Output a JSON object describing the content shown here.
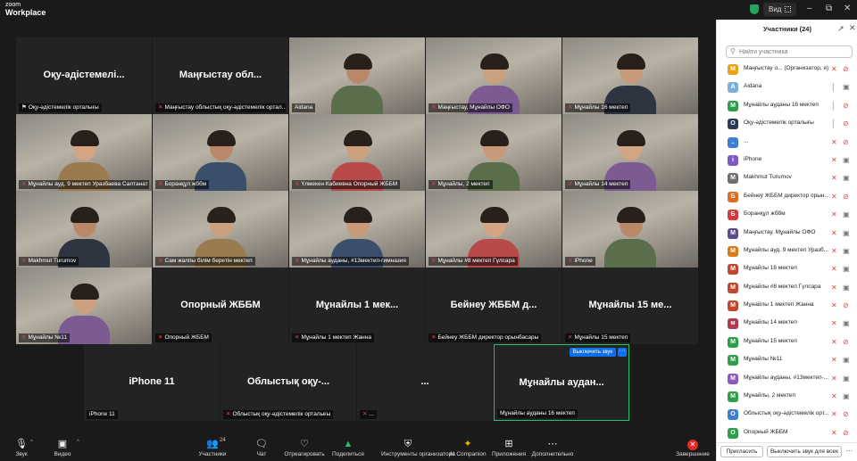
{
  "app": {
    "logo_line1": "zoom",
    "logo_line2": "Workplace",
    "view_label": "Вид",
    "colors": {
      "accent": "#0e71eb",
      "active_border": "#23c06a",
      "muted": "#e0454a",
      "security": "#23a55a"
    }
  },
  "tiles": [
    {
      "big": "Оқу-әдістемелі...",
      "caption": "Оқу-әдістемелік орталығы",
      "video": false,
      "pinned": true,
      "muted": false
    },
    {
      "big": "Маңғыстау обл...",
      "caption": "Маңғыстау облыстық оқу-әдістемелік ортал...",
      "video": false,
      "pinned": false,
      "muted": true
    },
    {
      "big": "",
      "caption": "Aidana",
      "video": true,
      "pinned": false,
      "muted": false
    },
    {
      "big": "",
      "caption": "Маңғыстау, Мұнайлы ОФО",
      "video": true,
      "pinned": false,
      "muted": true
    },
    {
      "big": "",
      "caption": "Мұнайлы 16 мектеп",
      "video": true,
      "pinned": false,
      "muted": true
    },
    {
      "big": "",
      "caption": "Мұнайлы ауд. 9 мектеп Уразбаева Салтанат ...",
      "video": true,
      "pinned": false,
      "muted": true
    },
    {
      "big": "",
      "caption": "Боранқұл жббм",
      "video": true,
      "pinned": false,
      "muted": true
    },
    {
      "big": "",
      "caption": "Үлмекен Кабиевна Опорный ЖББМ",
      "video": true,
      "pinned": false,
      "muted": true
    },
    {
      "big": "",
      "caption": "Мұнайлы, 2 мектеп",
      "video": true,
      "pinned": false,
      "muted": true
    },
    {
      "big": "",
      "caption": "Мұнайлы 14 мектеп",
      "video": true,
      "pinned": false,
      "muted": true
    },
    {
      "big": "",
      "caption": "Makhmut Turumov",
      "video": true,
      "pinned": false,
      "muted": true
    },
    {
      "big": "",
      "caption": "Сам жалпы білім беретін мектеп",
      "video": true,
      "pinned": false,
      "muted": true
    },
    {
      "big": "",
      "caption": "Мұнайлы ауданы, #13мектеп-гимназия",
      "video": true,
      "pinned": false,
      "muted": true
    },
    {
      "big": "",
      "caption": "Мұнайлы #8 мектеп Гүлсара",
      "video": true,
      "pinned": false,
      "muted": true
    },
    {
      "big": "",
      "caption": "iPhone",
      "video": true,
      "pinned": false,
      "muted": true
    },
    {
      "big": "",
      "caption": "Мұнайлы №11",
      "video": true,
      "pinned": false,
      "muted": true
    },
    {
      "big": "Опорный ЖББМ",
      "caption": "Опорный ЖББМ",
      "video": false,
      "pinned": false,
      "muted": true
    },
    {
      "big": "Мұнайлы 1 мек...",
      "caption": "Мұнайлы 1 мектеп Жанна",
      "video": false,
      "pinned": false,
      "muted": true
    },
    {
      "big": "Бейнеу ЖББМ д...",
      "caption": "Бейнеу ЖББМ директор орынбасары",
      "video": false,
      "pinned": false,
      "muted": true
    },
    {
      "big": "Мұнайлы 15 ме...",
      "caption": "Мұнайлы 15 мектеп",
      "video": false,
      "pinned": false,
      "muted": true
    },
    {
      "big": "iPhone 11",
      "caption": "iPhone 11",
      "video": false,
      "pinned": false,
      "muted": false
    },
    {
      "big": "Облыстық оқу-...",
      "caption": "Облыстық оқу-әдістемелік орталығы",
      "video": false,
      "pinned": false,
      "muted": true
    },
    {
      "big": "...",
      "caption": "...",
      "video": false,
      "pinned": false,
      "muted": true
    },
    {
      "big": "Мұнайлы аудан...",
      "caption": "Мұнайлы ауданы 16 мектеп",
      "video": false,
      "pinned": false,
      "muted": false,
      "active": true,
      "unmute_label": "Выключить звук",
      "more_label": "···"
    }
  ],
  "toolbar": {
    "audio": "Звук",
    "video": "Видео",
    "participants": "Участники",
    "participants_count": "24",
    "chat": "Чат",
    "react": "Отреагировать",
    "share": "Поделиться",
    "host_tools": "Инструменты организатора",
    "ai": "AI Companion",
    "apps": "Приложения",
    "more": "Дополнительно",
    "end": "Завершение"
  },
  "panel": {
    "title": "Участники (24)",
    "search_placeholder": "Найти участника",
    "invite": "Пригласить",
    "mute_all": "Выключить звук для всех",
    "more": "···",
    "participants": [
      {
        "initial": "М",
        "name": "Маңғыстау о... (Организатор, я)",
        "color": "#e8a317",
        "mic": "muted",
        "cam": "off"
      },
      {
        "initial": "A",
        "name": "Aidana",
        "color": "#7bb0d8",
        "mic": "on",
        "cam": "on"
      },
      {
        "initial": "М",
        "name": "Мұнайлы ауданы 16 мектеп",
        "color": "#2e9e4a",
        "mic": "on",
        "cam": "off"
      },
      {
        "initial": "О",
        "name": "Оқу-әдістемелік орталығы",
        "color": "#2b3a55",
        "mic": "on",
        "cam": "off"
      },
      {
        "initial": "..",
        "name": "...",
        "color": "#3d7fd1",
        "mic": "muted",
        "cam": "off"
      },
      {
        "initial": "i",
        "name": "iPhone",
        "color": "#7d5bbe",
        "mic": "muted",
        "cam": "on"
      },
      {
        "initial": "M",
        "name": "Makhmut Turumov",
        "color": "#6f6f6f",
        "mic": "muted",
        "cam": "on"
      },
      {
        "initial": "Б",
        "name": "Бейнеу ЖББМ директор орын...",
        "color": "#e26b1f",
        "mic": "muted",
        "cam": "off"
      },
      {
        "initial": "Б",
        "name": "Боранқұл жббм",
        "color": "#d83a3a",
        "mic": "muted",
        "cam": "on"
      },
      {
        "initial": "М",
        "name": "Маңғыстау, Мұнайлы ОФО",
        "color": "#5a4b8a",
        "mic": "muted",
        "cam": "on"
      },
      {
        "initial": "М",
        "name": "Мұнайлы ауд. 9 мектеп Уразб...",
        "color": "#d87a1f",
        "mic": "muted",
        "cam": "on"
      },
      {
        "initial": "М",
        "name": "Мұнайлы 16 мектеп",
        "color": "#c2462e",
        "mic": "muted",
        "cam": "on"
      },
      {
        "initial": "М",
        "name": "Мұнайлы #8 мектеп Гүлсара",
        "color": "#c2462e",
        "mic": "muted",
        "cam": "on"
      },
      {
        "initial": "М",
        "name": "Мұнайлы 1 мектеп Жанна",
        "color": "#c2462e",
        "mic": "muted",
        "cam": "off"
      },
      {
        "initial": "м",
        "name": "Мұнайлы 14 мектеп",
        "color": "#b03a4f",
        "mic": "muted",
        "cam": "on"
      },
      {
        "initial": "М",
        "name": "Мұнайлы 15 мектеп",
        "color": "#2e9e4a",
        "mic": "muted",
        "cam": "off"
      },
      {
        "initial": "М",
        "name": "Мұнайлы №11",
        "color": "#2e9e4a",
        "mic": "muted",
        "cam": "on"
      },
      {
        "initial": "М",
        "name": "Мұнайлы ауданы, #13мектеп-...",
        "color": "#8a5bbe",
        "mic": "muted",
        "cam": "on"
      },
      {
        "initial": "М",
        "name": "Мұнайлы, 2 мектеп",
        "color": "#2e9e4a",
        "mic": "muted",
        "cam": "on"
      },
      {
        "initial": "О",
        "name": "Облыстық оқу-әдістемелік орт...",
        "color": "#3d7fd1",
        "mic": "muted",
        "cam": "off"
      },
      {
        "initial": "О",
        "name": "Опорный ЖББМ",
        "color": "#2e9e4a",
        "mic": "muted",
        "cam": "off"
      }
    ]
  }
}
